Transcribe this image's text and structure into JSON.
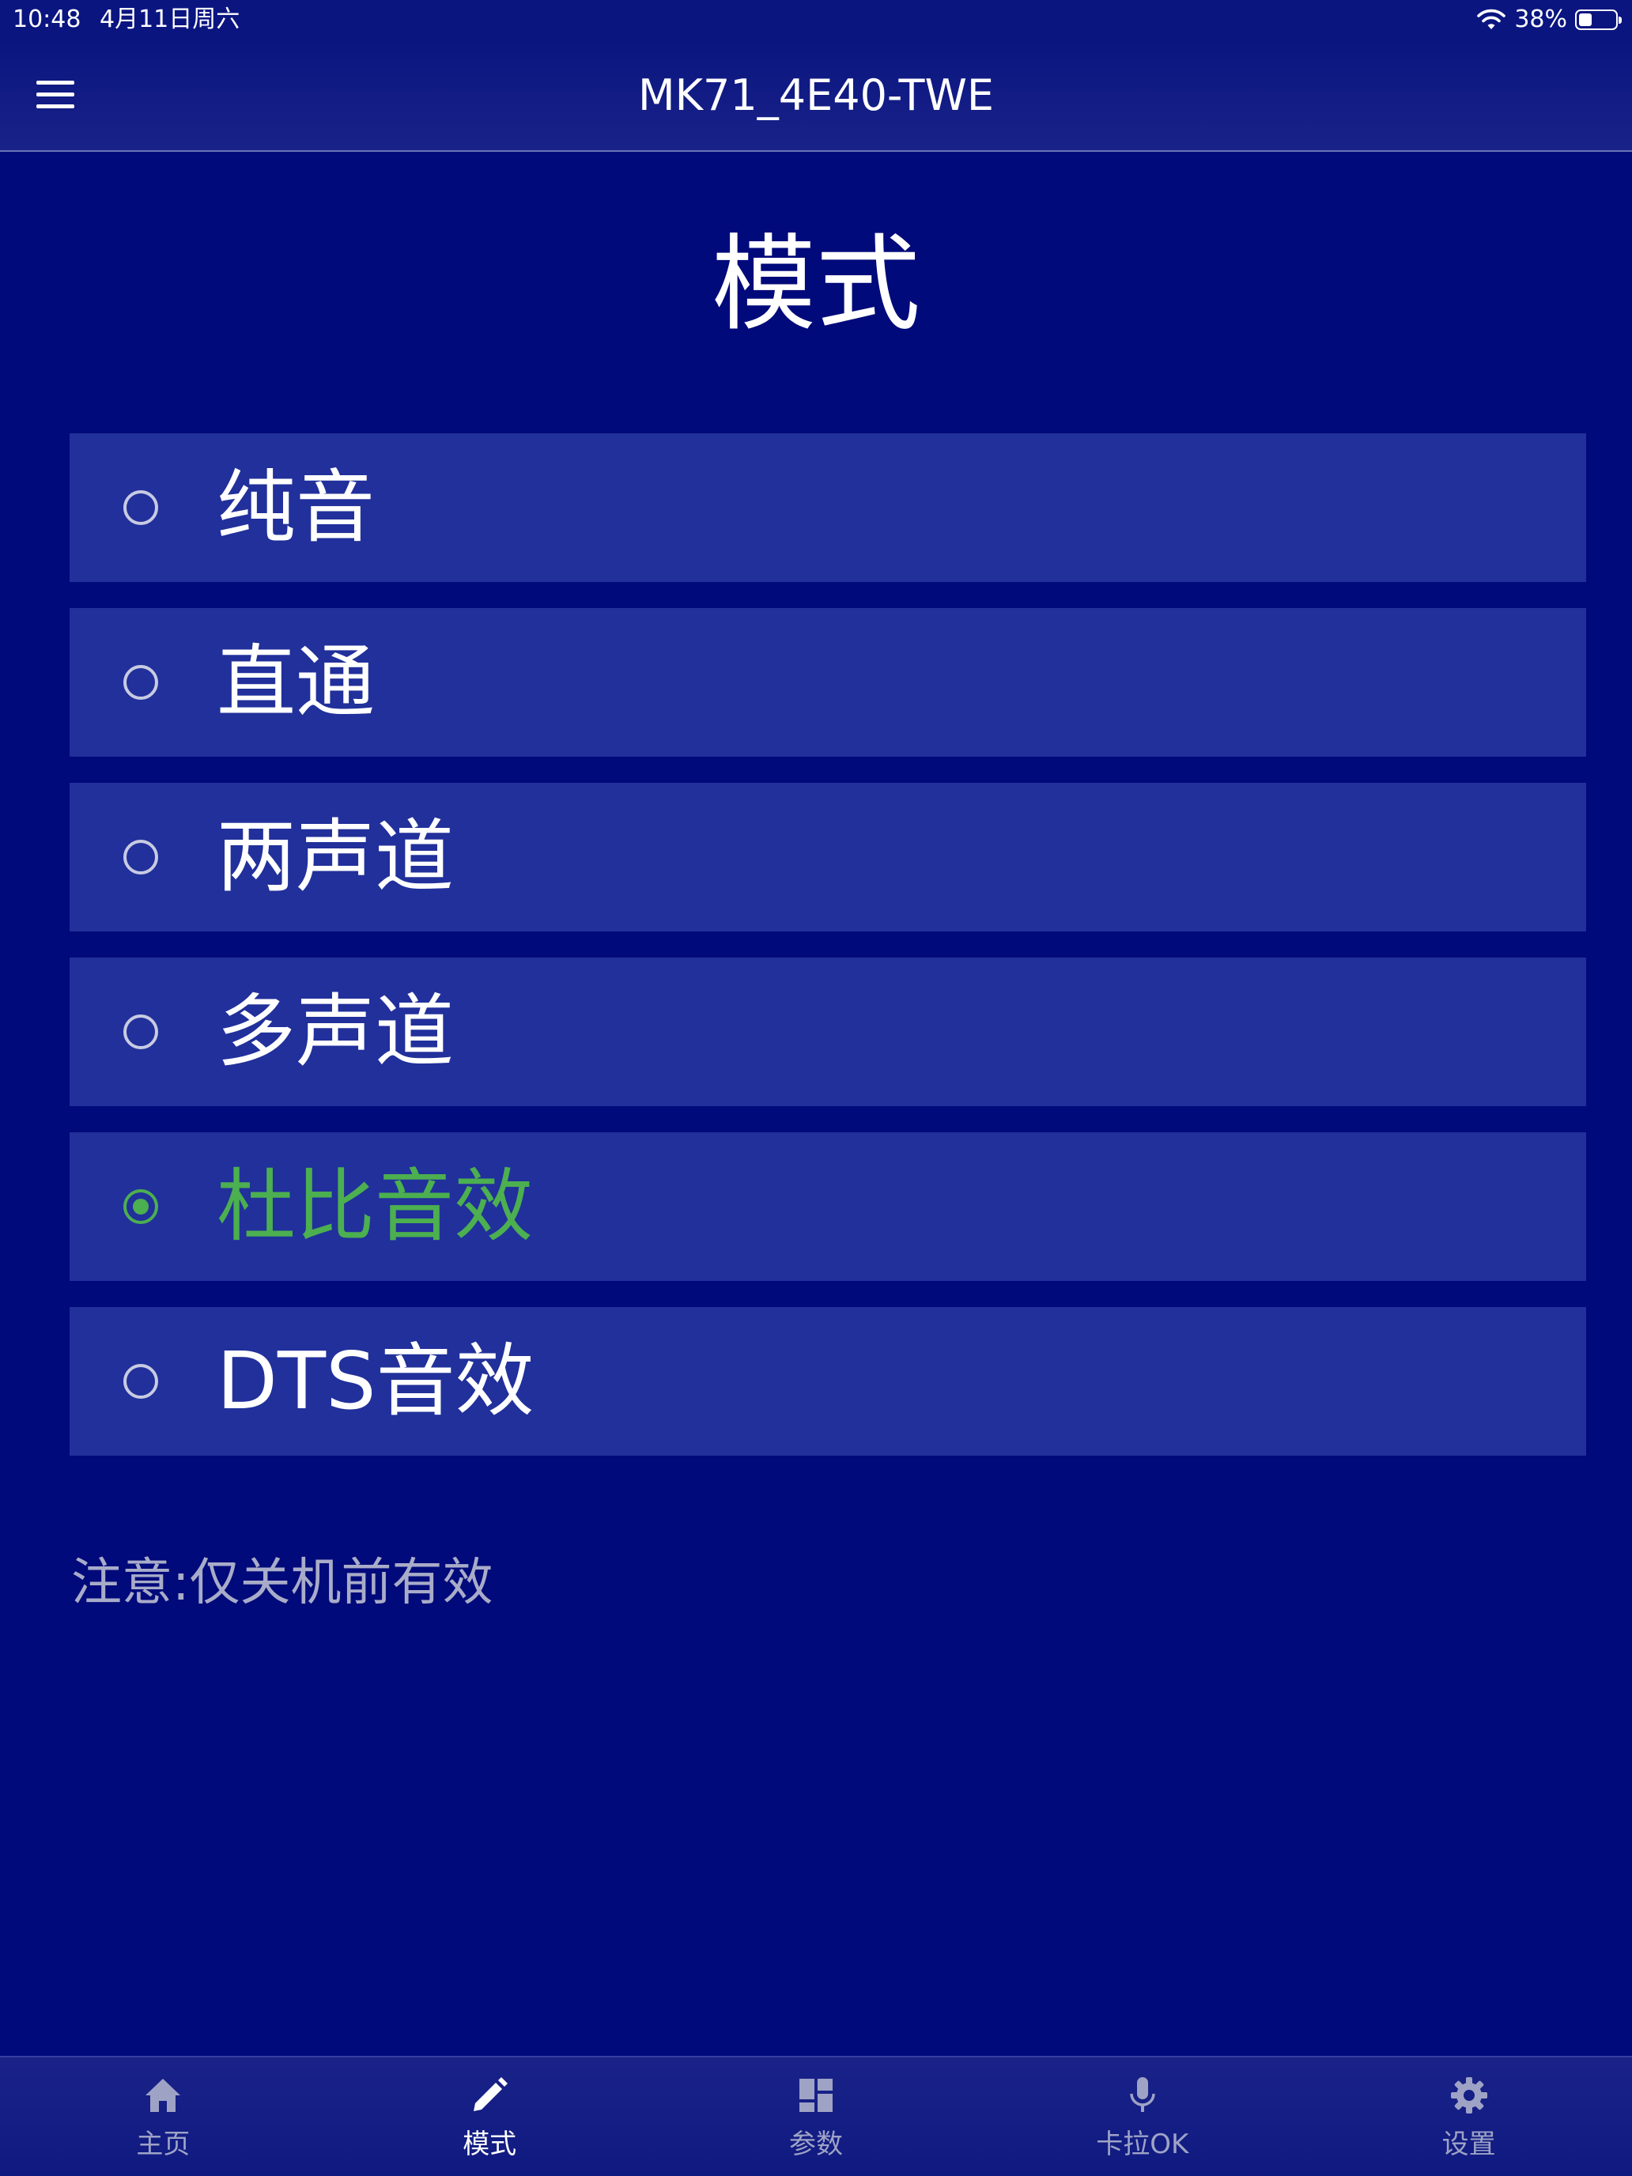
{
  "status_bar": {
    "time": "10:48",
    "date": "4月11日周六",
    "battery": "38%"
  },
  "nav": {
    "title": "MK71_4E40-TWE"
  },
  "page": {
    "title": "模式",
    "note": "注意:仅关机前有效"
  },
  "modes": [
    {
      "label": "纯音",
      "selected": false
    },
    {
      "label": "直通",
      "selected": false
    },
    {
      "label": "两声道",
      "selected": false
    },
    {
      "label": "多声道",
      "selected": false
    },
    {
      "label": "杜比音效",
      "selected": true
    },
    {
      "label": "DTS音效",
      "selected": false
    }
  ],
  "tabs": [
    {
      "label": "主页",
      "icon": "home-icon",
      "active": false
    },
    {
      "label": "模式",
      "icon": "pencil-icon",
      "active": true
    },
    {
      "label": "参数",
      "icon": "dashboard-icon",
      "active": false
    },
    {
      "label": "卡拉OK",
      "icon": "microphone-icon",
      "active": false
    },
    {
      "label": "设置",
      "icon": "gear-icon",
      "active": false
    }
  ],
  "colors": {
    "background": "#010a7a",
    "option_background": "#21309b",
    "selected": "#4caf50",
    "note_text": "#a8acc8",
    "tab_inactive": "#9ea3c6"
  }
}
